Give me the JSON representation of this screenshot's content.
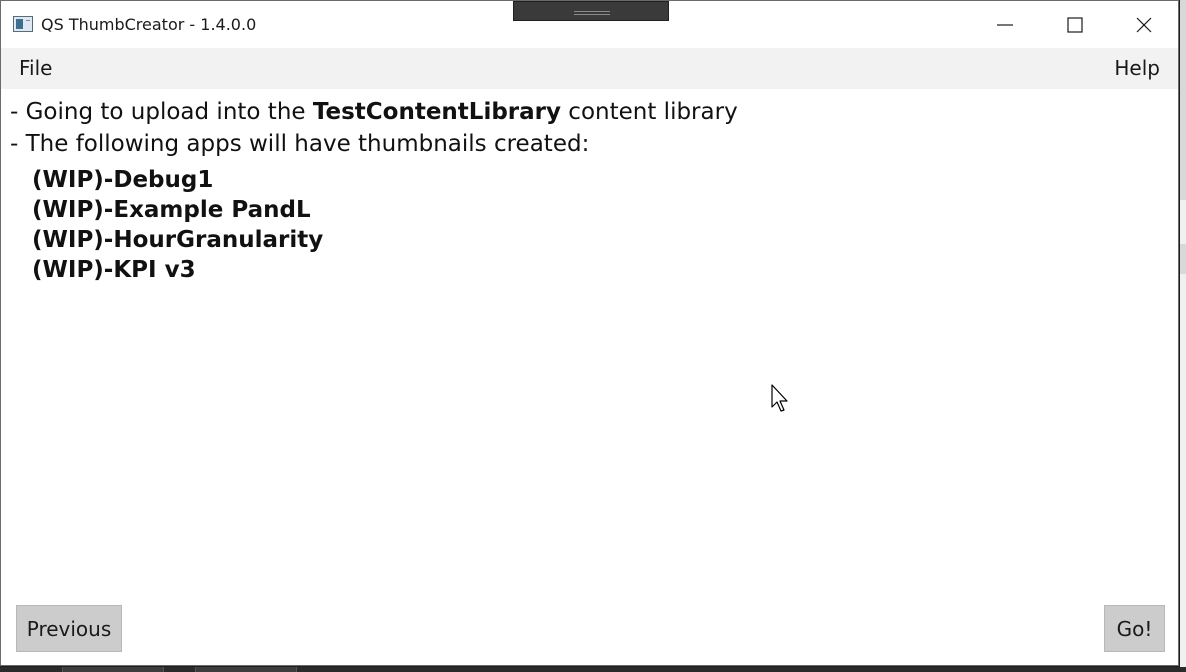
{
  "window": {
    "title": "QS ThumbCreator - 1.4.0.0"
  },
  "menu": {
    "file": "File",
    "help": "Help"
  },
  "content": {
    "line1_prefix": "- Going to upload into the ",
    "line1_library": "TestContentLibrary",
    "line1_suffix": " content library",
    "line2": "- The following apps will have thumbnails created:",
    "apps": [
      "(WIP)-Debug1",
      "(WIP)-Example PandL",
      "(WIP)-HourGranularity",
      "(WIP)-KPI v3"
    ]
  },
  "buttons": {
    "previous": "Previous",
    "go": "Go!"
  },
  "icons": {
    "app": "app-window-icon",
    "minimize": "minimize-icon",
    "maximize": "maximize-icon",
    "close": "close-icon",
    "cursor": "mouse-pointer-icon"
  }
}
